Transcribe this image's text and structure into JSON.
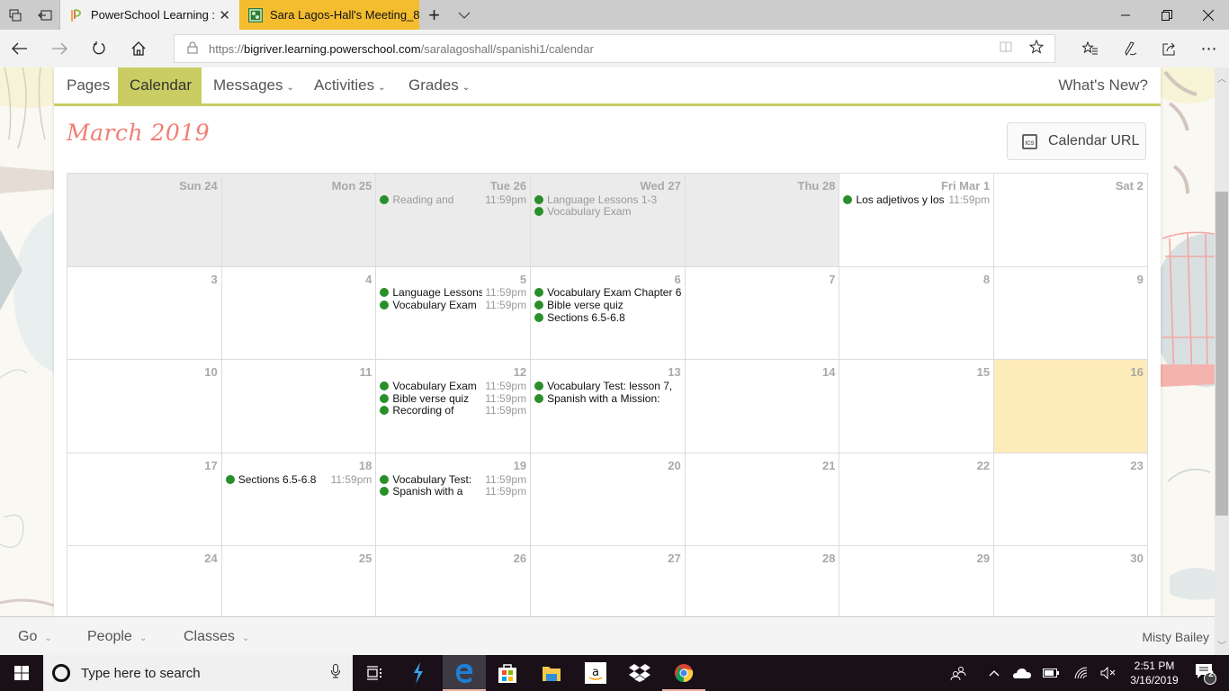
{
  "browser": {
    "tabs": [
      {
        "label": "PowerSchool Learning :",
        "active": true
      },
      {
        "label": "Sara Lagos-Hall's Meeting_8",
        "active": false
      }
    ],
    "url": {
      "prefix": "https://",
      "host": "bigriver.learning.powerschool.com",
      "path": "/saralagoshall/spanishi1/calendar"
    },
    "new_tab_label": "+",
    "tab_actions_label": "⌵"
  },
  "course_nav": {
    "items": [
      {
        "label": "Pages",
        "dropdown": false,
        "active": false
      },
      {
        "label": "Calendar",
        "dropdown": false,
        "active": true
      },
      {
        "label": "Messages",
        "dropdown": true,
        "active": false
      },
      {
        "label": "Activities",
        "dropdown": true,
        "active": false
      },
      {
        "label": "Grades",
        "dropdown": true,
        "active": false
      }
    ],
    "whats_new": "What's New?"
  },
  "calendar": {
    "title": "March 2019",
    "calendar_url_label": "Calendar URL",
    "calendar_url_icon": "ICS",
    "weeks": [
      [
        {
          "label": "Sun 24",
          "state": "past",
          "events": []
        },
        {
          "label": "Mon 25",
          "state": "past",
          "events": []
        },
        {
          "label": "Tue 26",
          "state": "past",
          "events": [
            {
              "title": "Reading and",
              "time": "11:59pm"
            }
          ]
        },
        {
          "label": "Wed 27",
          "state": "past",
          "events": [
            {
              "title": "Language Lessons 1-3",
              "time": ""
            },
            {
              "title": "Vocabulary Exam",
              "time": ""
            }
          ]
        },
        {
          "label": "Thu 28",
          "state": "past",
          "events": []
        },
        {
          "label": "Fri Mar 1",
          "state": "normal",
          "events": [
            {
              "title": "Los adjetivos y los",
              "time": "11:59pm"
            }
          ]
        },
        {
          "label": "Sat 2",
          "state": "normal",
          "events": []
        }
      ],
      [
        {
          "label": "3",
          "state": "normal",
          "events": []
        },
        {
          "label": "4",
          "state": "normal",
          "events": []
        },
        {
          "label": "5",
          "state": "normal",
          "events": [
            {
              "title": "Language Lessons",
              "time": "11:59pm"
            },
            {
              "title": "Vocabulary Exam",
              "time": "11:59pm"
            }
          ]
        },
        {
          "label": "6",
          "state": "normal",
          "events": [
            {
              "title": "Vocabulary Exam Chapter 6",
              "time": ""
            },
            {
              "title": "Bible verse quiz",
              "time": ""
            },
            {
              "title": "Sections 6.5-6.8",
              "time": ""
            }
          ]
        },
        {
          "label": "7",
          "state": "normal",
          "events": []
        },
        {
          "label": "8",
          "state": "normal",
          "events": []
        },
        {
          "label": "9",
          "state": "normal",
          "events": []
        }
      ],
      [
        {
          "label": "10",
          "state": "normal",
          "events": []
        },
        {
          "label": "11",
          "state": "normal",
          "events": []
        },
        {
          "label": "12",
          "state": "normal",
          "events": [
            {
              "title": "Vocabulary Exam",
              "time": "11:59pm"
            },
            {
              "title": "Bible verse quiz",
              "time": "11:59pm"
            },
            {
              "title": "Recording of",
              "time": "11:59pm"
            }
          ]
        },
        {
          "label": "13",
          "state": "normal",
          "events": [
            {
              "title": "Vocabulary Test: lesson 7,",
              "time": ""
            },
            {
              "title": "Spanish with a Mission:",
              "time": ""
            }
          ]
        },
        {
          "label": "14",
          "state": "normal",
          "events": []
        },
        {
          "label": "15",
          "state": "normal",
          "events": []
        },
        {
          "label": "16",
          "state": "today",
          "events": []
        }
      ],
      [
        {
          "label": "17",
          "state": "normal",
          "events": []
        },
        {
          "label": "18",
          "state": "normal",
          "events": [
            {
              "title": "Sections 6.5-6.8",
              "time": "11:59pm"
            }
          ]
        },
        {
          "label": "19",
          "state": "normal",
          "events": [
            {
              "title": "Vocabulary Test:",
              "time": "11:59pm"
            },
            {
              "title": "Spanish with a",
              "time": "11:59pm"
            }
          ]
        },
        {
          "label": "20",
          "state": "normal",
          "events": []
        },
        {
          "label": "21",
          "state": "normal",
          "events": []
        },
        {
          "label": "22",
          "state": "normal",
          "events": []
        },
        {
          "label": "23",
          "state": "normal",
          "events": []
        }
      ],
      [
        {
          "label": "24",
          "state": "normal",
          "events": []
        },
        {
          "label": "25",
          "state": "normal",
          "events": []
        },
        {
          "label": "26",
          "state": "normal",
          "events": []
        },
        {
          "label": "27",
          "state": "normal",
          "events": []
        },
        {
          "label": "28",
          "state": "normal",
          "events": []
        },
        {
          "label": "29",
          "state": "normal",
          "events": []
        },
        {
          "label": "30",
          "state": "normal",
          "events": []
        }
      ]
    ]
  },
  "app_bar": {
    "items": [
      {
        "label": "Go"
      },
      {
        "label": "People"
      },
      {
        "label": "Classes"
      }
    ],
    "user_name": "Misty Bailey"
  },
  "taskbar": {
    "search_placeholder": "Type here to search",
    "clock_time": "2:51 PM",
    "clock_date": "3/16/2019",
    "notification_count": "2"
  },
  "colors": {
    "accent": "#c9cd63",
    "title": "#f07f74",
    "event_dot": "#2a8f2a",
    "today": "#fdebb9",
    "past_day": "#ebebeb",
    "active_tab": "#f3bd2f"
  }
}
